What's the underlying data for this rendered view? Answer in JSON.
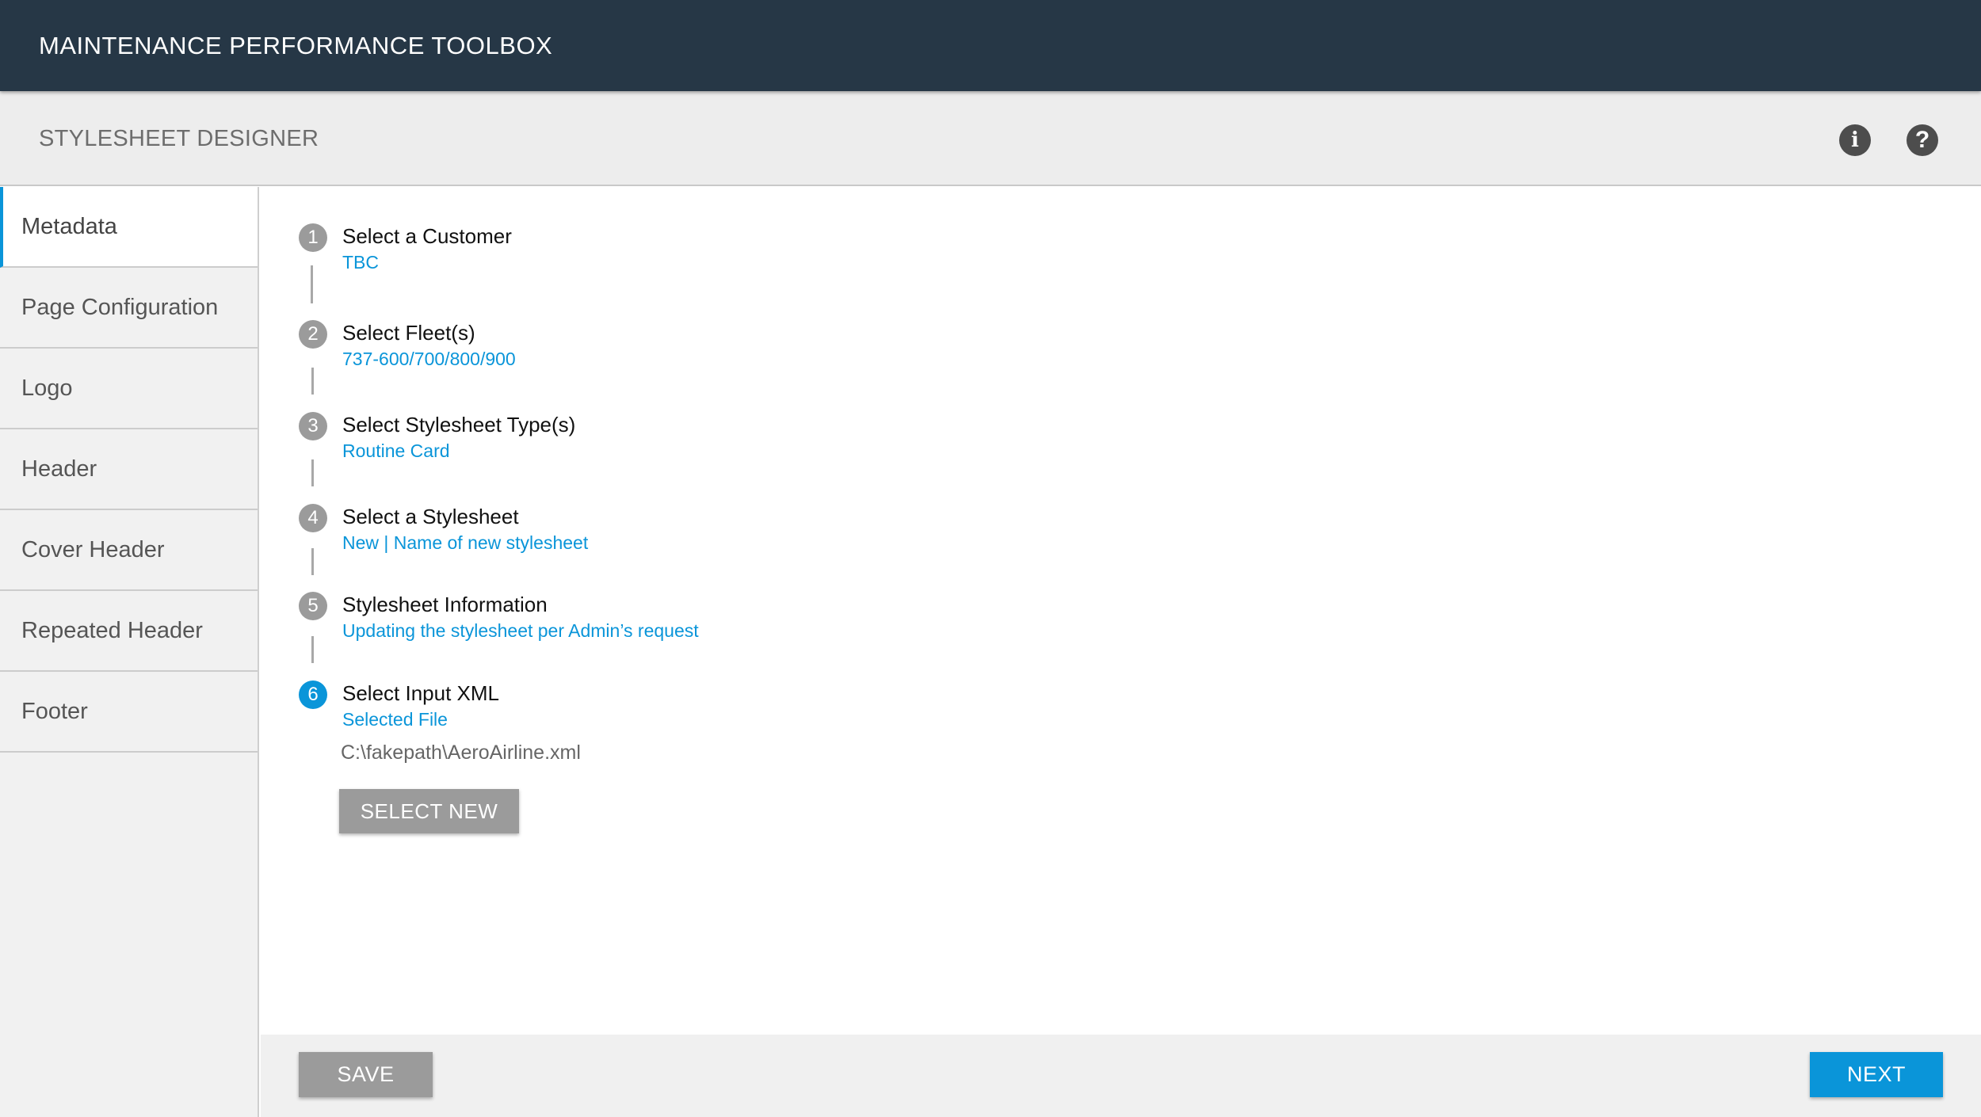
{
  "app": {
    "title": "MAINTENANCE PERFORMANCE TOOLBOX"
  },
  "header": {
    "page_title": "STYLESHEET DESIGNER",
    "info_icon_glyph": "i",
    "help_icon_glyph": "?"
  },
  "sidebar": {
    "items": [
      {
        "label": "Metadata",
        "active": true
      },
      {
        "label": "Page Configuration",
        "active": false
      },
      {
        "label": "Logo",
        "active": false
      },
      {
        "label": "Header",
        "active": false
      },
      {
        "label": "Cover Header",
        "active": false
      },
      {
        "label": "Repeated Header",
        "active": false
      },
      {
        "label": "Footer",
        "active": false
      }
    ]
  },
  "steps": [
    {
      "number": "1",
      "title": "Select a Customer",
      "value": "TBC"
    },
    {
      "number": "2",
      "title": "Select Fleet(s)",
      "value": "737-600/700/800/900"
    },
    {
      "number": "3",
      "title": "Select Stylesheet Type(s)",
      "value": "Routine Card"
    },
    {
      "number": "4",
      "title": "Select a Stylesheet",
      "value": "New | Name of new stylesheet"
    },
    {
      "number": "5",
      "title": "Stylesheet Information",
      "value": "Updating the stylesheet per Admin’s request"
    },
    {
      "number": "6",
      "title": "Select Input XML",
      "value": "Selected File",
      "active": true
    }
  ],
  "input_xml": {
    "file_path": "C:\\fakepath\\AeroAirline.xml",
    "select_new_label": "SELECT NEW"
  },
  "footer": {
    "save_label": "SAVE",
    "next_label": "NEXT"
  },
  "colors": {
    "topbar": "#263746",
    "accent": "#0a95d9",
    "step_inactive": "#9b9b9b"
  }
}
